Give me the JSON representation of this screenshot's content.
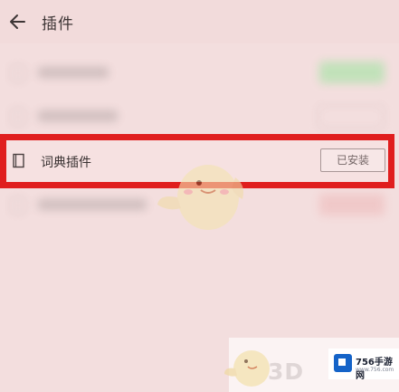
{
  "header": {
    "title": "插件",
    "back_icon": "back-arrow-icon"
  },
  "plugin_row": {
    "icon": "book-icon",
    "label": "词典插件",
    "status_button": "已安装"
  },
  "highlight": {
    "color": "#e01e1e"
  },
  "watermark": {
    "brand": "756手游网",
    "sub": "www.756.com",
    "overlay_text": "3D"
  }
}
